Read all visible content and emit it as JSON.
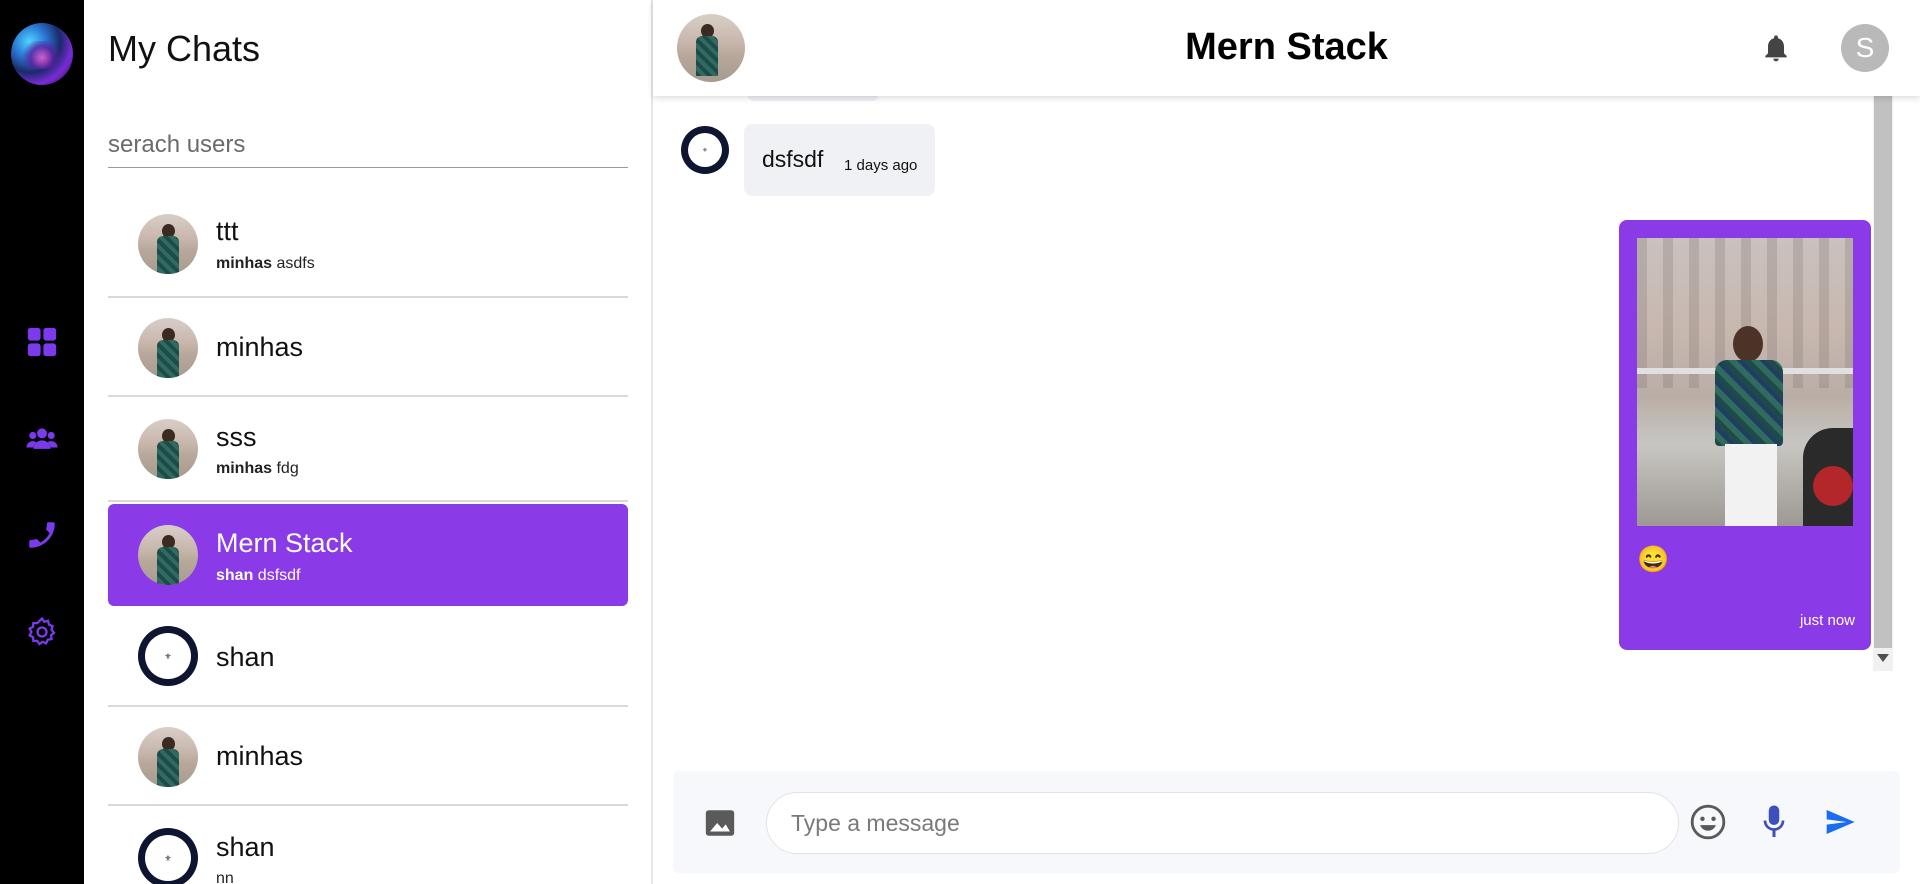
{
  "sidebar": {
    "logo": "app-logo",
    "icons": [
      "dashboard-icon",
      "groups-icon",
      "phone-icon",
      "settings-icon"
    ],
    "accent": "#7c3aed"
  },
  "chat_list": {
    "title": "My Chats",
    "search_placeholder": "serach users",
    "items": [
      {
        "name": "ttt",
        "sender": "minhas",
        "message": "asdfs",
        "avatar": "photo"
      },
      {
        "name": "minhas",
        "sender": "",
        "message": "",
        "avatar": "photo"
      },
      {
        "name": "sss",
        "sender": "minhas",
        "message": "fdg",
        "avatar": "photo"
      },
      {
        "name": "Mern Stack",
        "sender": "shan",
        "message": "dsfsdf",
        "avatar": "photo",
        "active": true
      },
      {
        "name": "shan",
        "sender": "",
        "message": "",
        "avatar": "logo"
      },
      {
        "name": "minhas",
        "sender": "",
        "message": "",
        "avatar": "photo"
      },
      {
        "name": "shan",
        "sender": "",
        "message": "nn",
        "avatar": "logo"
      }
    ]
  },
  "conversation": {
    "title": "Mern Stack",
    "user_initial": "S",
    "messages": [
      {
        "direction": "in",
        "text": "dsfsdf",
        "time": "1 days ago"
      },
      {
        "direction": "out",
        "image": "photo",
        "emoji": "😄",
        "time": "just now"
      }
    ]
  },
  "composer": {
    "placeholder": "Type a message"
  },
  "colors": {
    "active_chat": "#8a3ae6",
    "outgoing_bubble": "#8a3ae6",
    "incoming_bubble": "#f0f1f5",
    "send_icon": "#1a6cf0"
  }
}
